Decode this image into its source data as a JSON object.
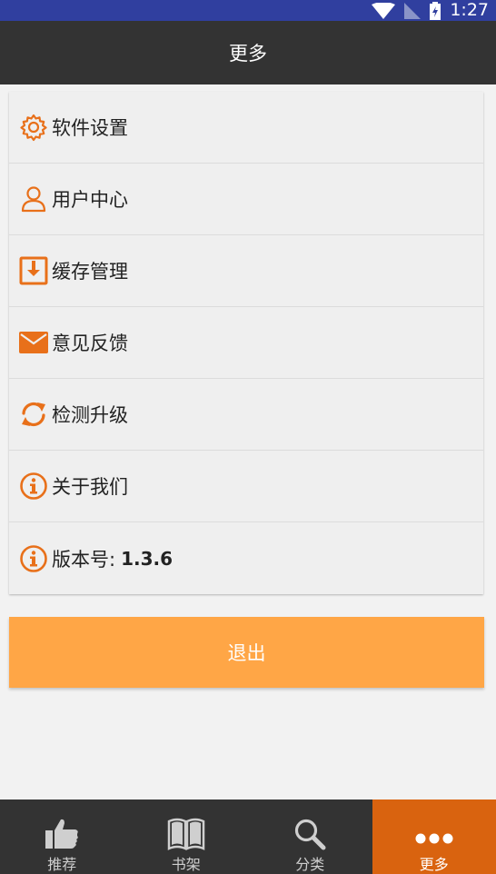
{
  "status_bar": {
    "time": "1:27"
  },
  "app_bar": {
    "title": "更多"
  },
  "menu": {
    "items": [
      {
        "label": "软件设置",
        "icon": "gear-icon"
      },
      {
        "label": "用户中心",
        "icon": "user-icon"
      },
      {
        "label": "缓存管理",
        "icon": "download-icon"
      },
      {
        "label": "意见反馈",
        "icon": "envelope-icon"
      },
      {
        "label": "检测升级",
        "icon": "refresh-icon"
      },
      {
        "label": "关于我们",
        "icon": "info-icon"
      },
      {
        "label": "版本号:",
        "value": "1.3.6",
        "icon": "info-icon"
      }
    ]
  },
  "logout": {
    "label": "退出"
  },
  "bottom_nav": {
    "items": [
      {
        "label": "推荐",
        "icon": "thumbs-up-icon"
      },
      {
        "label": "书架",
        "icon": "book-icon"
      },
      {
        "label": "分类",
        "icon": "search-icon"
      },
      {
        "label": "更多",
        "icon": "more-icon",
        "active": true
      }
    ]
  },
  "colors": {
    "accent": "#e8701a",
    "logout_bg": "#ffa646",
    "active_tab": "#d9630f",
    "app_bar": "#333333",
    "status_bar": "#303f9f"
  }
}
